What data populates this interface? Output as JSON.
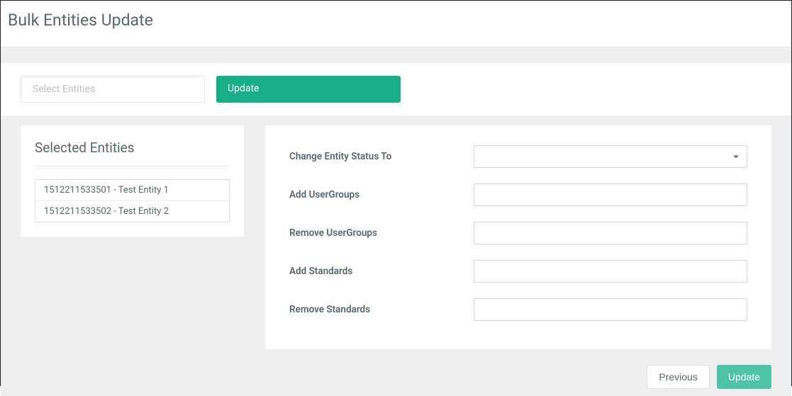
{
  "header": {
    "title": "Bulk Entities Update"
  },
  "tabs": {
    "select_entities": "Select Entities",
    "update": "Update"
  },
  "left_panel": {
    "title": "Selected Entities",
    "entities": [
      "1512211533501 - Test Entity 1",
      "1512211533502 - Test Entity 2"
    ]
  },
  "form": {
    "change_status": {
      "label": "Change Entity Status To",
      "value": ""
    },
    "add_usergroups": {
      "label": "Add UserGroups",
      "value": ""
    },
    "remove_usergroups": {
      "label": "Remove UserGroups",
      "value": ""
    },
    "add_standards": {
      "label": "Add Standards",
      "value": ""
    },
    "remove_standards": {
      "label": "Remove Standards",
      "value": ""
    }
  },
  "footer": {
    "previous": "Previous",
    "update": "Update"
  }
}
